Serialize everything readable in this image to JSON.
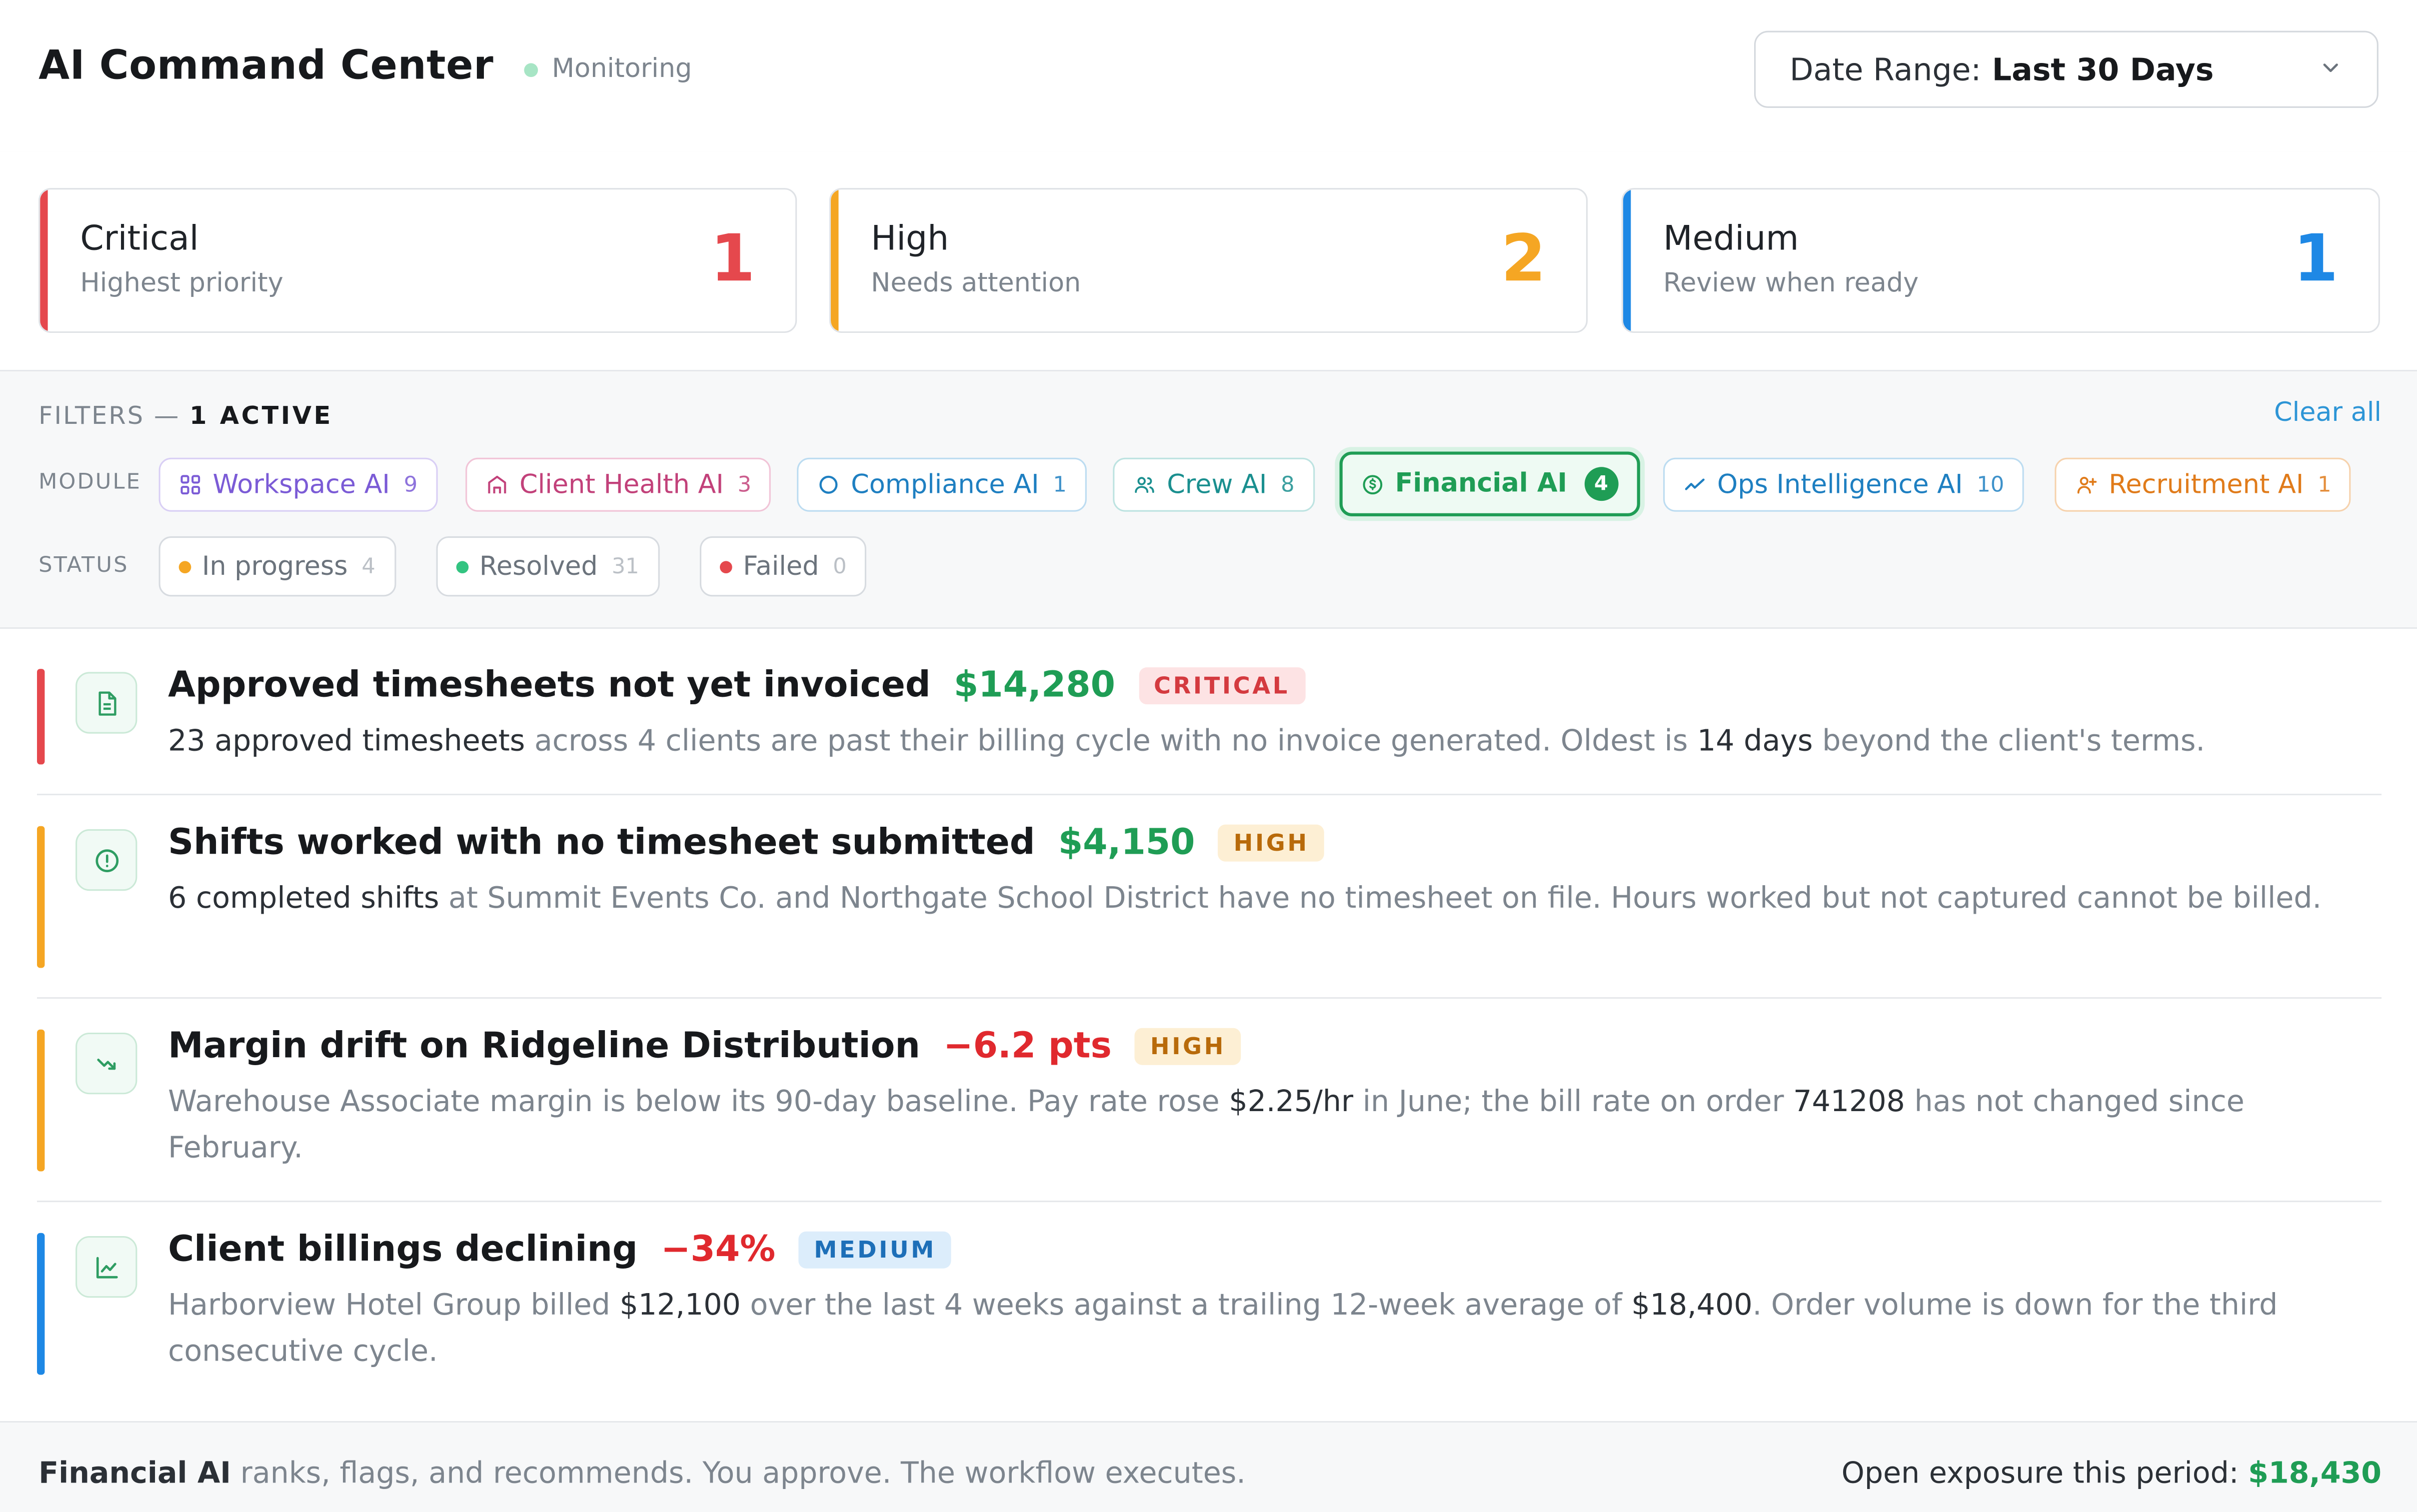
{
  "header": {
    "title": "AI Command Center",
    "status": "Monitoring",
    "date_range": {
      "label": "Date Range:",
      "value": "Last 30 Days"
    }
  },
  "priority_cards": [
    {
      "title": "Critical",
      "subtitle": "Highest priority",
      "count": "1",
      "color": "#e5484d"
    },
    {
      "title": "High",
      "subtitle": "Needs attention",
      "count": "2",
      "color": "#f5a623"
    },
    {
      "title": "Medium",
      "subtitle": "Review when ready",
      "count": "1",
      "color": "#1e88e5"
    }
  ],
  "filters": {
    "label": "FILTERS —",
    "active": "1 ACTIVE",
    "clear_all": "Clear all",
    "module_label": "MODULE",
    "status_label": "STATUS",
    "modules": [
      {
        "label": "Workspace AI",
        "count": "9",
        "color": "#7b5bd6",
        "border": "#d9cff5",
        "icon": "grid-icon"
      },
      {
        "label": "Client Health AI",
        "count": "3",
        "color": "#c2417a",
        "border": "#f1c4d7",
        "icon": "building-icon"
      },
      {
        "label": "Compliance AI",
        "count": "1",
        "color": "#1e7fc1",
        "border": "#bcdcf1",
        "icon": "circle-icon"
      },
      {
        "label": "Crew AI",
        "count": "8",
        "color": "#1a8f8f",
        "border": "#bde3e1",
        "icon": "users-icon"
      },
      {
        "label": "Financial AI",
        "count": "4",
        "color": "#1f9d55",
        "border": "#1f9d55",
        "icon": "dollar-circle-icon",
        "active": true
      },
      {
        "label": "Ops Intelligence AI",
        "count": "10",
        "color": "#1e7fc1",
        "border": "#bcdcf1",
        "icon": "pulse-icon"
      },
      {
        "label": "Recruitment AI",
        "count": "1",
        "color": "#e07b1a",
        "border": "#f6d2ad",
        "icon": "user-plus-icon"
      }
    ],
    "statuses": [
      {
        "label": "In progress",
        "count": "4",
        "color": "#f5a623"
      },
      {
        "label": "Resolved",
        "count": "31",
        "color": "#33c481"
      },
      {
        "label": "Failed",
        "count": "0",
        "color": "#e5484d"
      }
    ]
  },
  "alerts": [
    {
      "title": "Approved timesheets not yet invoiced",
      "metric": "$14,280",
      "metric_color": "#1f9d55",
      "badge": "CRITICAL",
      "badge_color": "#d43a3f",
      "badge_bg": "#fde3e4",
      "bar_color": "#e5484d",
      "icon": "document-icon",
      "segments": [
        {
          "text": "23 approved timesheets",
          "hl": true
        },
        {
          "text": " across 4 clients are past their billing cycle with no invoice generated. Oldest is ",
          "hl": false
        },
        {
          "text": "14 days",
          "hl": true
        },
        {
          "text": " beyond the client's terms.",
          "hl": false
        }
      ]
    },
    {
      "title": "Shifts worked with no timesheet submitted",
      "metric": "$4,150",
      "metric_color": "#1f9d55",
      "badge": "HIGH",
      "badge_color": "#b86a0a",
      "badge_bg": "#fdefd4",
      "bar_color": "#f5a623",
      "icon": "alert-circle-icon",
      "segments": [
        {
          "text": "6 completed shifts",
          "hl": true
        },
        {
          "text": " at Summit Events Co. and Northgate School District have no timesheet on file. Hours worked but not captured cannot be billed.",
          "hl": false
        }
      ]
    },
    {
      "title": "Margin drift on Ridgeline Distribution",
      "metric": "−6.2 pts",
      "metric_color": "#e0292e",
      "badge": "HIGH",
      "badge_color": "#b86a0a",
      "badge_bg": "#fdefd4",
      "bar_color": "#f5a623",
      "icon": "trending-down-icon",
      "segments": [
        {
          "text": "Warehouse Associate margin is below its 90-day baseline. Pay rate rose ",
          "hl": false
        },
        {
          "text": "$2.25/hr",
          "hl": true
        },
        {
          "text": " in June; the bill rate on order ",
          "hl": false
        },
        {
          "text": "741208",
          "hl": true
        },
        {
          "text": " has not changed since February.",
          "hl": false
        }
      ]
    },
    {
      "title": "Client billings declining",
      "metric": "−34%",
      "metric_color": "#e0292e",
      "badge": "MEDIUM",
      "badge_color": "#1d6fb8",
      "badge_bg": "#dcedfb",
      "bar_color": "#1e88e5",
      "icon": "chart-icon",
      "segments": [
        {
          "text": "Harborview Hotel Group billed ",
          "hl": false
        },
        {
          "text": "$12,100",
          "hl": true
        },
        {
          "text": " over the last 4 weeks against a trailing 12-week average of ",
          "hl": false
        },
        {
          "text": "$18,400",
          "hl": true
        },
        {
          "text": ". Order volume is down for the third consecutive cycle.",
          "hl": false
        }
      ]
    }
  ],
  "footer": {
    "brand": "Financial AI",
    "tagline": " ranks, flags, and recommends. You approve. The workflow executes.",
    "exposure_label": "Open exposure this period: ",
    "exposure_value": "$18,430"
  }
}
